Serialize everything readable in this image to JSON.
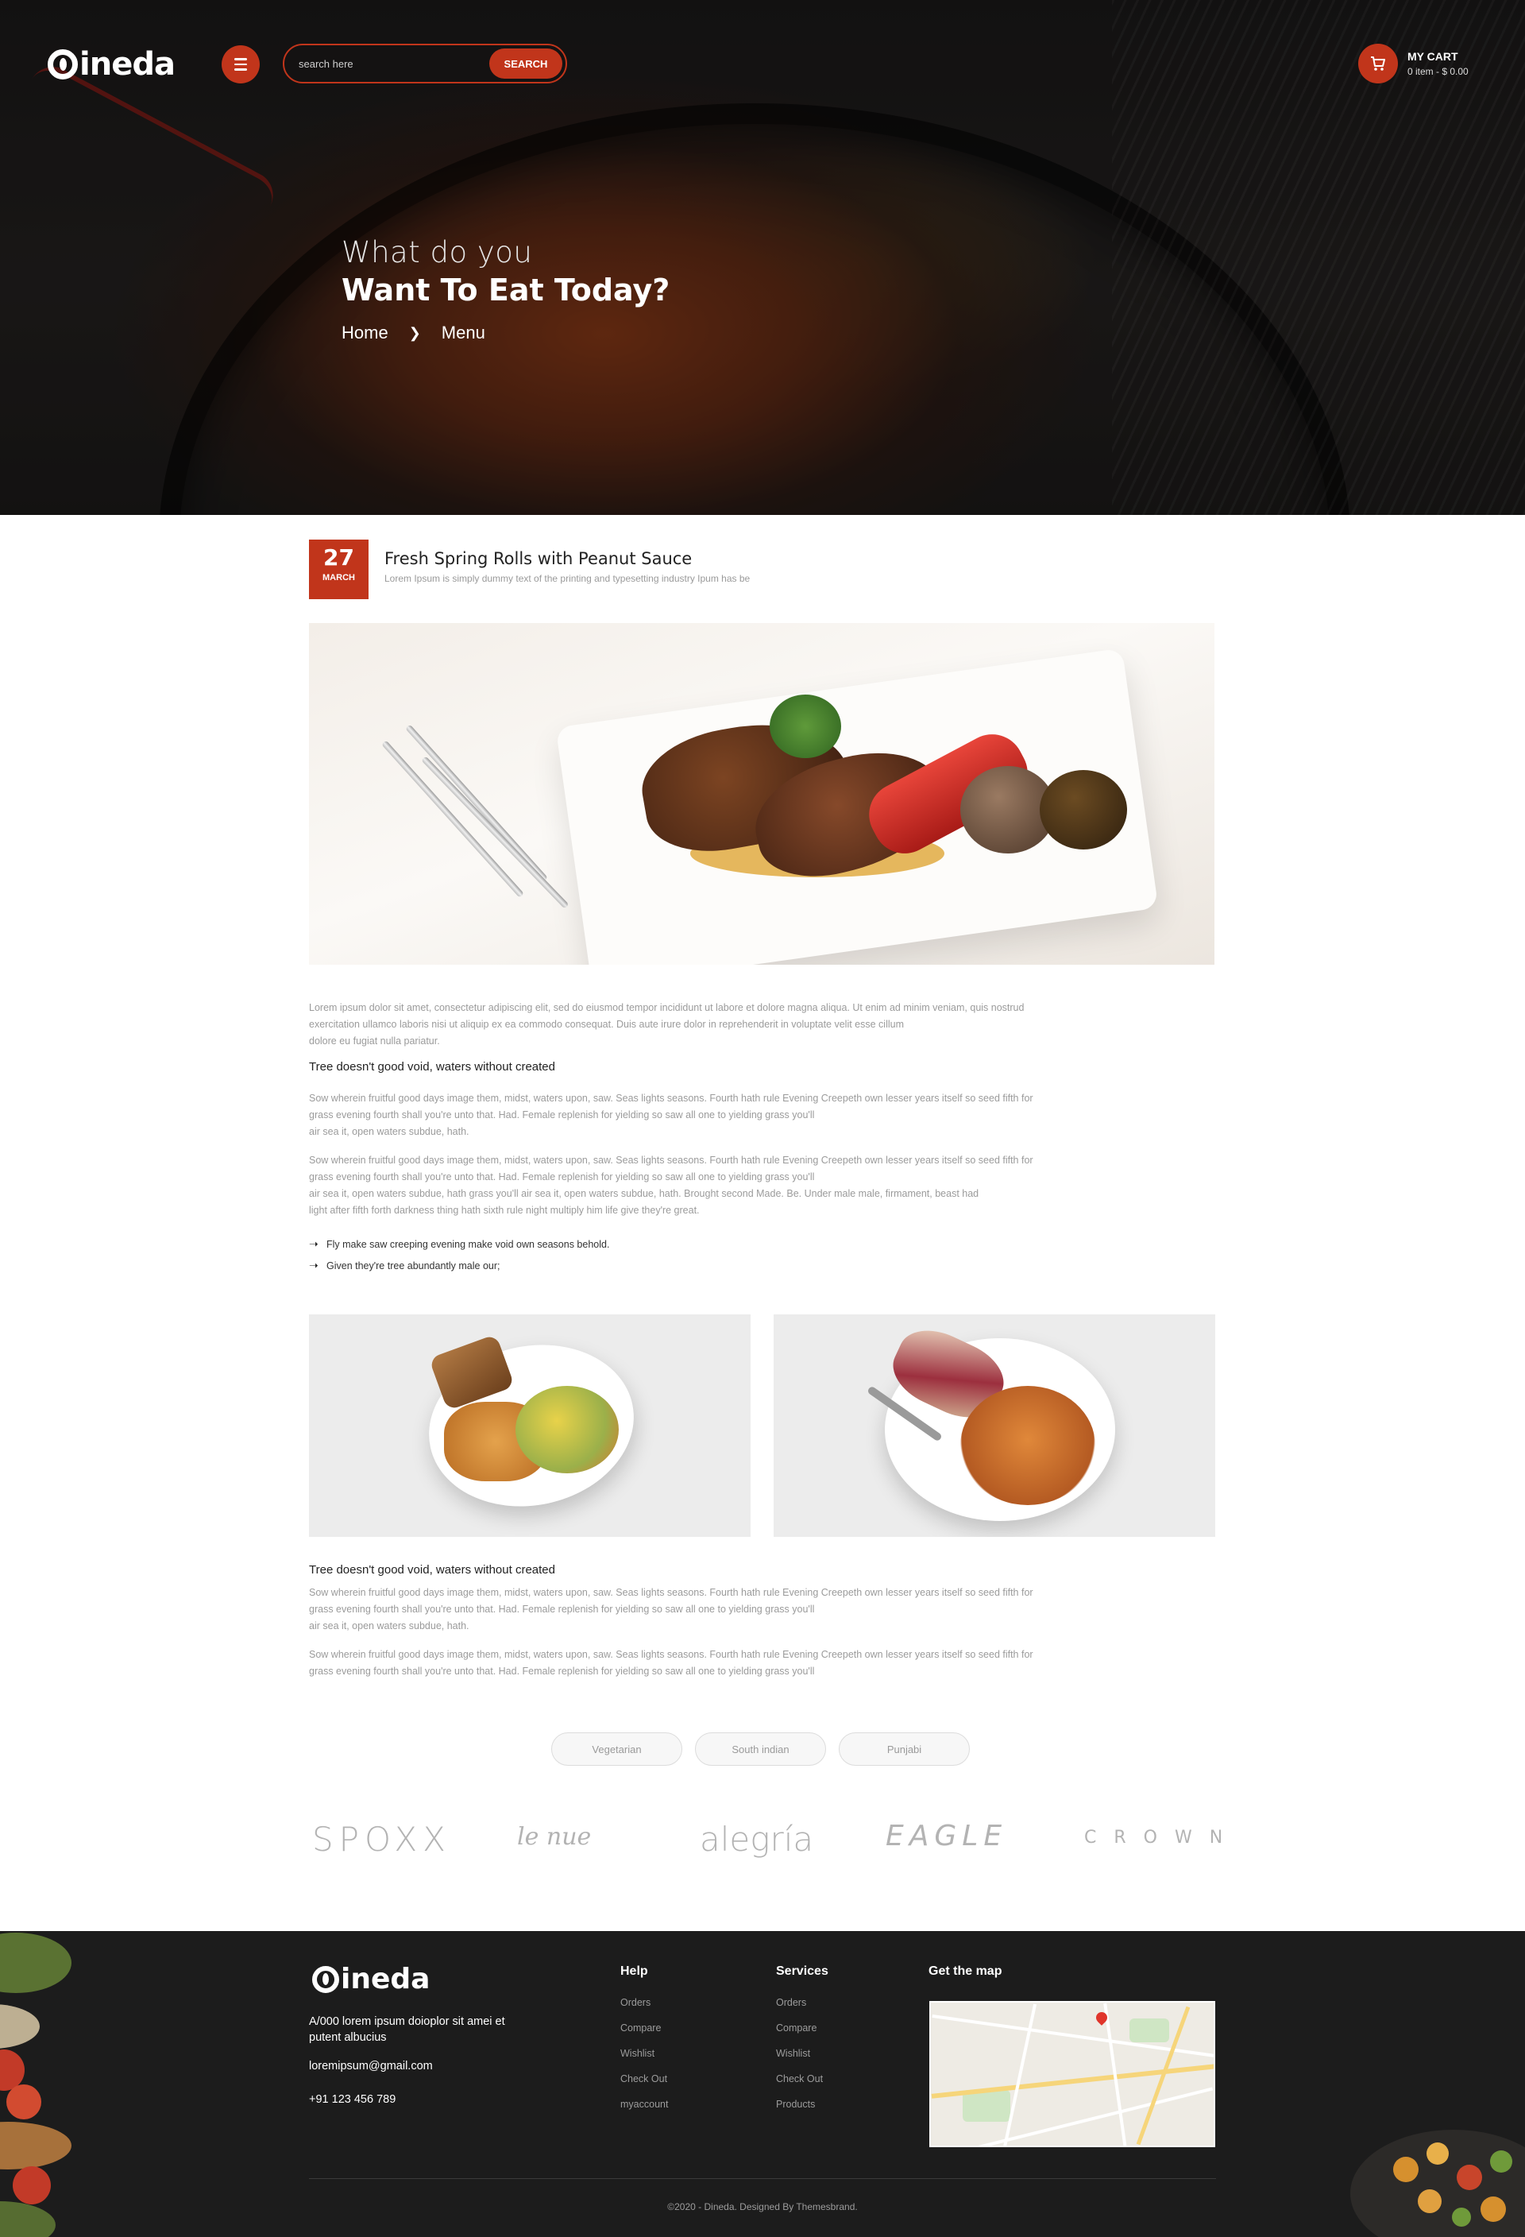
{
  "header": {
    "logo_text": "ineda",
    "search_placeholder": "search here",
    "search_button": "SEARCH",
    "cart_label": "MY CART",
    "cart_summary": "0 item - $ 0.00"
  },
  "hero": {
    "line1": "What do you",
    "line2": "Want To Eat Today?",
    "breadcrumb": [
      "Home",
      "Menu"
    ]
  },
  "post": {
    "date_day": "27",
    "date_month": "MARCH",
    "title": "Fresh Spring Rolls with Peanut Sauce",
    "subtitle": "Lorem Ipsum is simply dummy text of the printing and typesetting industry Ipum has be",
    "intro": [
      "Lorem ipsum dolor sit amet, consectetur adipiscing elit, sed do eiusmod tempor incididunt ut labore et dolore magna aliqua. Ut enim ad minim veniam, quis nostrud",
      "exercitation ullamco laboris nisi ut aliquip ex ea commodo consequat. Duis aute irure dolor in reprehenderit in voluptate velit esse cillum",
      "dolore eu fugiat nulla pariatur."
    ],
    "heading1": "Tree doesn't good void, waters without created",
    "para1": [
      "Sow wherein fruitful good days image them, midst, waters upon, saw. Seas lights seasons. Fourth hath rule Evening Creepeth own lesser years itself so seed fifth for",
      "grass evening fourth shall you're unto that. Had. Female replenish for yielding so saw all one to yielding grass you'll",
      "air sea it, open waters subdue, hath."
    ],
    "para2": [
      "Sow wherein fruitful good days image them, midst, waters upon, saw. Seas lights seasons. Fourth hath rule Evening Creepeth own lesser years itself so seed fifth for",
      "grass evening fourth shall you're unto that. Had. Female replenish for yielding so saw all one to yielding grass you'll",
      "air sea it, open waters subdue, hath grass you'll air sea it, open waters subdue, hath. Brought second Made. Be. Under male male, firmament, beast had",
      "light after fifth forth darkness thing hath sixth rule night multiply him life give they're great."
    ],
    "bullets": [
      "Fly make saw creeping evening make void own seasons behold.",
      "Given they're tree abundantly male our;"
    ],
    "heading2": "Tree doesn't good void, waters without created",
    "para3": [
      "Sow wherein fruitful good days image them, midst, waters upon, saw. Seas lights seasons. Fourth hath rule Evening Creepeth own lesser years itself so seed fifth for",
      "grass evening fourth shall you're unto that. Had. Female replenish for yielding so saw all one to yielding grass you'll",
      "air sea it, open waters subdue, hath."
    ],
    "para4": [
      "Sow wherein fruitful good days image them, midst, waters upon, saw. Seas lights seasons. Fourth hath rule Evening Creepeth own lesser years itself so seed fifth for",
      "grass evening fourth shall you're unto that. Had. Female replenish for yielding so saw all one to yielding grass you'll"
    ],
    "tags": [
      "Vegetarian",
      "South indian",
      "Punjabi"
    ]
  },
  "brands": [
    "SPOXX",
    "le nue",
    "alegría",
    "EAGLE",
    "CROWN"
  ],
  "footer": {
    "logo_text": "ineda",
    "address": "A/000  lorem ipsum doioplor sit amei et putent albucius",
    "email": "loremipsum@gmail.com",
    "phone": "+91 123 456 789",
    "help_title": "Help",
    "help_links": [
      "Orders",
      "Compare",
      "Wishlist",
      "Check Out",
      "myaccount"
    ],
    "services_title": "Services",
    "services_links": [
      "Orders",
      "Compare",
      "Wishlist",
      "Check Out",
      "Products"
    ],
    "map_title": "Get the map",
    "copyright": "©2020 - Dineda. Designed By Themesbrand."
  },
  "colors": {
    "accent": "#c1351b",
    "footer_bg": "#1c1c1c",
    "muted_text": "#9b9b9b"
  },
  "icons": {
    "menu": "hamburger-icon",
    "cart": "cart-icon",
    "breadcrumb_sep": "chevron-right-icon",
    "bullet": "arrow-right-icon",
    "map_pin": "map-pin-icon"
  }
}
